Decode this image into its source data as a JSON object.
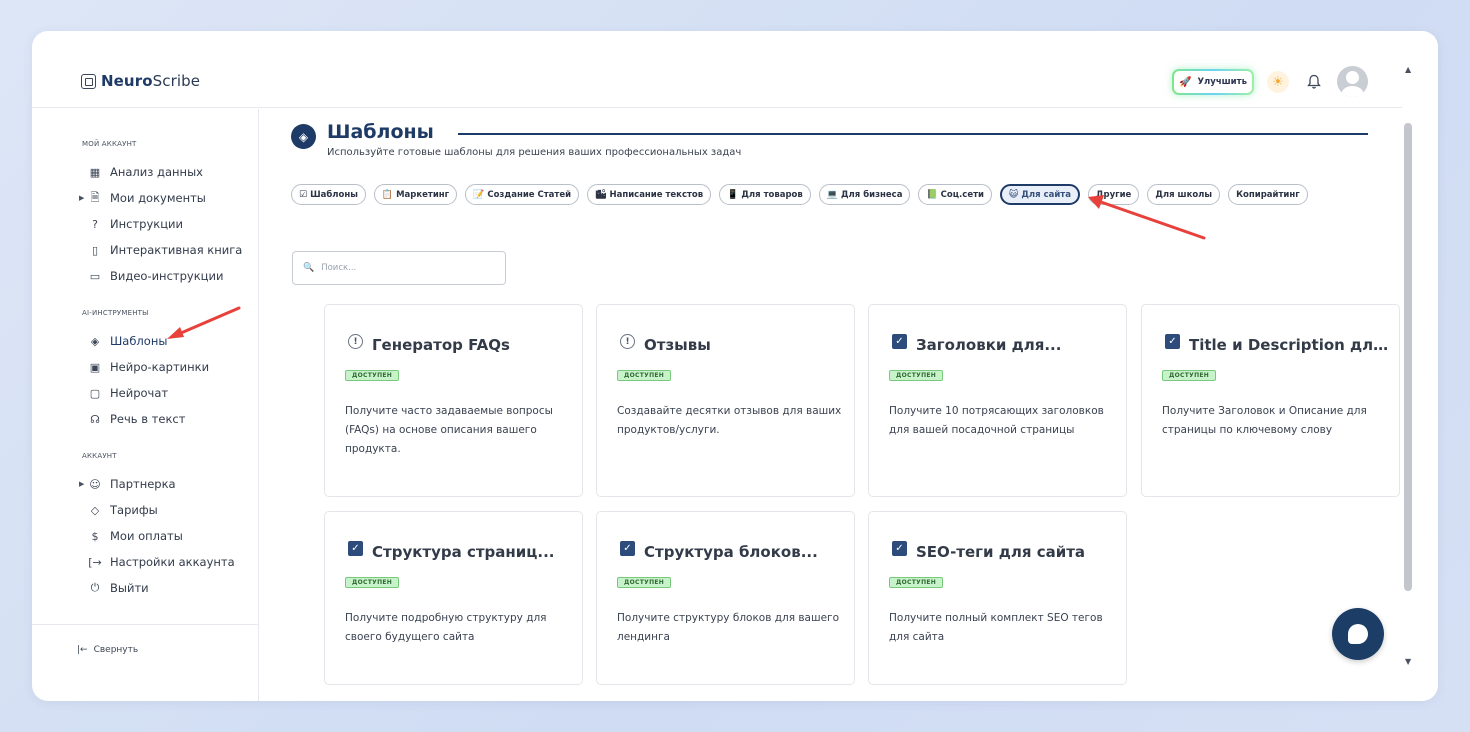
{
  "app": {
    "logo_bold": "Neuro",
    "logo_rest": "Scribe",
    "upgrade_label": "Улучшить"
  },
  "sidebar": {
    "sections": [
      {
        "title": "МОЙ АККАУНТ",
        "items": [
          {
            "label": "Анализ данных",
            "icon": "grid-icon",
            "caret": false
          },
          {
            "label": "Мои документы",
            "icon": "document-icon",
            "caret": true
          },
          {
            "label": "Инструкции",
            "icon": "help-circle-icon",
            "caret": false
          },
          {
            "label": "Интерактивная книга",
            "icon": "book-icon",
            "caret": false
          },
          {
            "label": "Видео-инструкции",
            "icon": "video-icon",
            "caret": false
          }
        ]
      },
      {
        "title": "AI-ИНСТРУМЕНТЫ",
        "items": [
          {
            "label": "Шаблоны",
            "icon": "layers-icon",
            "caret": false,
            "active": true
          },
          {
            "label": "Нейро-картинки",
            "icon": "image-icon",
            "caret": false
          },
          {
            "label": "Нейрочат",
            "icon": "chat-icon",
            "caret": false
          },
          {
            "label": "Речь в текст",
            "icon": "headphones-icon",
            "caret": false
          }
        ]
      },
      {
        "title": "АККАУНТ",
        "items": [
          {
            "label": "Партнерка",
            "icon": "users-icon",
            "caret": true
          },
          {
            "label": "Тарифы",
            "icon": "tag-icon",
            "caret": false
          },
          {
            "label": "Мои оплаты",
            "icon": "dollar-icon",
            "caret": false
          },
          {
            "label": "Настройки аккаунта",
            "icon": "logout-arrow-icon",
            "caret": false
          },
          {
            "label": "Выйти",
            "icon": "power-icon",
            "caret": false
          }
        ]
      }
    ],
    "collapse_label": "Свернуть"
  },
  "main": {
    "title": "Шаблоны",
    "subtitle": "Используйте готовые шаблоны для решения ваших профессиональных задач",
    "search_placeholder": "Поиск...",
    "tags": [
      {
        "label": "Шаблоны",
        "emoji": "☑"
      },
      {
        "label": "Маркетинг",
        "emoji": "📋"
      },
      {
        "label": "Создание Статей",
        "emoji": "📝"
      },
      {
        "label": "Написание текстов",
        "emoji": "🏙"
      },
      {
        "label": "Для товаров",
        "emoji": "📱"
      },
      {
        "label": "Для бизнеса",
        "emoji": "💻"
      },
      {
        "label": "Соц.сети",
        "emoji": "📗"
      },
      {
        "label": "Для сайта",
        "emoji": "😺",
        "active": true
      },
      {
        "label": "Другие",
        "emoji": ""
      },
      {
        "label": "Для школы",
        "emoji": ""
      },
      {
        "label": "Копирайтинг",
        "emoji": ""
      }
    ],
    "cards": [
      {
        "title": "Генератор FAQs",
        "badge": "доступен",
        "icon": "info",
        "description": "Получите часто задаваемые вопросы (FAQs) на основе описания вашего продукта."
      },
      {
        "title": "Отзывы",
        "badge": "доступен",
        "icon": "info",
        "description": "Создавайте десятки отзывов для ваших продуктов/услуги."
      },
      {
        "title": "Заголовки для...",
        "badge": "доступен",
        "icon": "check",
        "description": "Получите 10 потрясающих заголовков для вашей посадочной страницы"
      },
      {
        "title": "Title и Description для...",
        "badge": "доступен",
        "icon": "check",
        "description": "Получите Заголовок и Описание для страницы по ключевому слову"
      },
      {
        "title": "Структура страниц...",
        "badge": "доступен",
        "icon": "check",
        "description": "Получите подробную структуру для своего будущего сайта"
      },
      {
        "title": "Структура блоков...",
        "badge": "доступен",
        "icon": "check",
        "description": "Получите структуру блоков для вашего лендинга"
      },
      {
        "title": "SEO-теги для сайта",
        "badge": "доступен",
        "icon": "check",
        "description": "Получите полный комплект SEO тегов для сайта"
      }
    ]
  },
  "colors": {
    "accent": "#1e3a66",
    "badge_bg": "#c8f2c9",
    "arrow": "#e8413b"
  }
}
